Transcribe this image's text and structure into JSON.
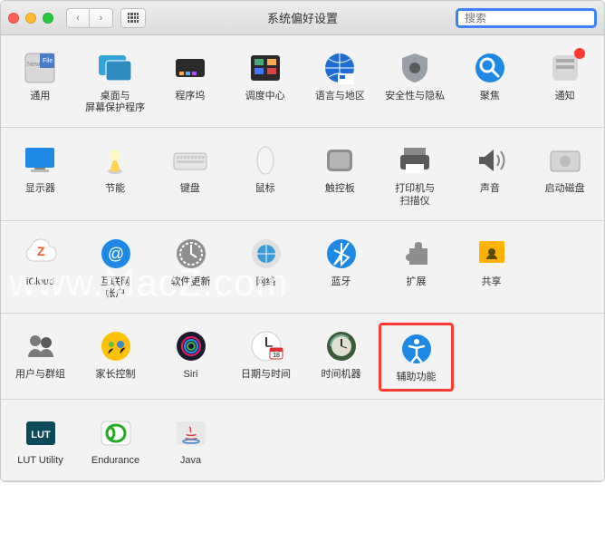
{
  "window": {
    "title": "系统偏好设置"
  },
  "search": {
    "placeholder": "搜索"
  },
  "watermark_text": "www.MacZ.com",
  "sections": [
    {
      "items": [
        {
          "id": "general",
          "label": "通用",
          "icon": "general"
        },
        {
          "id": "desktop",
          "label": "桌面与\n屏幕保护程序",
          "icon": "desktop"
        },
        {
          "id": "dock",
          "label": "程序坞",
          "icon": "dock"
        },
        {
          "id": "mission",
          "label": "调度中心",
          "icon": "mission"
        },
        {
          "id": "language",
          "label": "语言与地区",
          "icon": "language"
        },
        {
          "id": "security",
          "label": "安全性与隐私",
          "icon": "security"
        },
        {
          "id": "spotlight",
          "label": "聚焦",
          "icon": "spotlight"
        },
        {
          "id": "notifications",
          "label": "通知",
          "icon": "notifications",
          "badge": true
        }
      ]
    },
    {
      "items": [
        {
          "id": "displays",
          "label": "显示器",
          "icon": "displays"
        },
        {
          "id": "energy",
          "label": "节能",
          "icon": "energy"
        },
        {
          "id": "keyboard",
          "label": "键盘",
          "icon": "keyboard"
        },
        {
          "id": "mouse",
          "label": "鼠标",
          "icon": "mouse"
        },
        {
          "id": "trackpad",
          "label": "触控板",
          "icon": "trackpad"
        },
        {
          "id": "printers",
          "label": "打印机与\n扫描仪",
          "icon": "printers"
        },
        {
          "id": "sound",
          "label": "声音",
          "icon": "sound"
        },
        {
          "id": "startup",
          "label": "启动磁盘",
          "icon": "startup"
        }
      ]
    },
    {
      "items": [
        {
          "id": "icloud",
          "label": "iCloud",
          "icon": "icloud"
        },
        {
          "id": "internet",
          "label": "互联网\n帐户",
          "icon": "internet"
        },
        {
          "id": "update",
          "label": "软件更新",
          "icon": "update"
        },
        {
          "id": "network",
          "label": "网络",
          "icon": "network"
        },
        {
          "id": "bluetooth",
          "label": "蓝牙",
          "icon": "bluetooth"
        },
        {
          "id": "extensions",
          "label": "扩展",
          "icon": "extensions"
        },
        {
          "id": "sharing",
          "label": "共享",
          "icon": "sharing"
        }
      ]
    },
    {
      "items": [
        {
          "id": "users",
          "label": "用户与群组",
          "icon": "users"
        },
        {
          "id": "parental",
          "label": "家长控制",
          "icon": "parental"
        },
        {
          "id": "siri",
          "label": "Siri",
          "icon": "siri"
        },
        {
          "id": "datetime",
          "label": "日期与时间",
          "icon": "datetime"
        },
        {
          "id": "timemachine",
          "label": "时间机器",
          "icon": "timemachine"
        },
        {
          "id": "accessibility",
          "label": "辅助功能",
          "icon": "accessibility",
          "highlight": true
        }
      ]
    },
    {
      "items": [
        {
          "id": "lut",
          "label": "LUT Utility",
          "icon": "lut"
        },
        {
          "id": "endurance",
          "label": "Endurance",
          "icon": "endurance"
        },
        {
          "id": "java",
          "label": "Java",
          "icon": "java"
        }
      ]
    }
  ]
}
